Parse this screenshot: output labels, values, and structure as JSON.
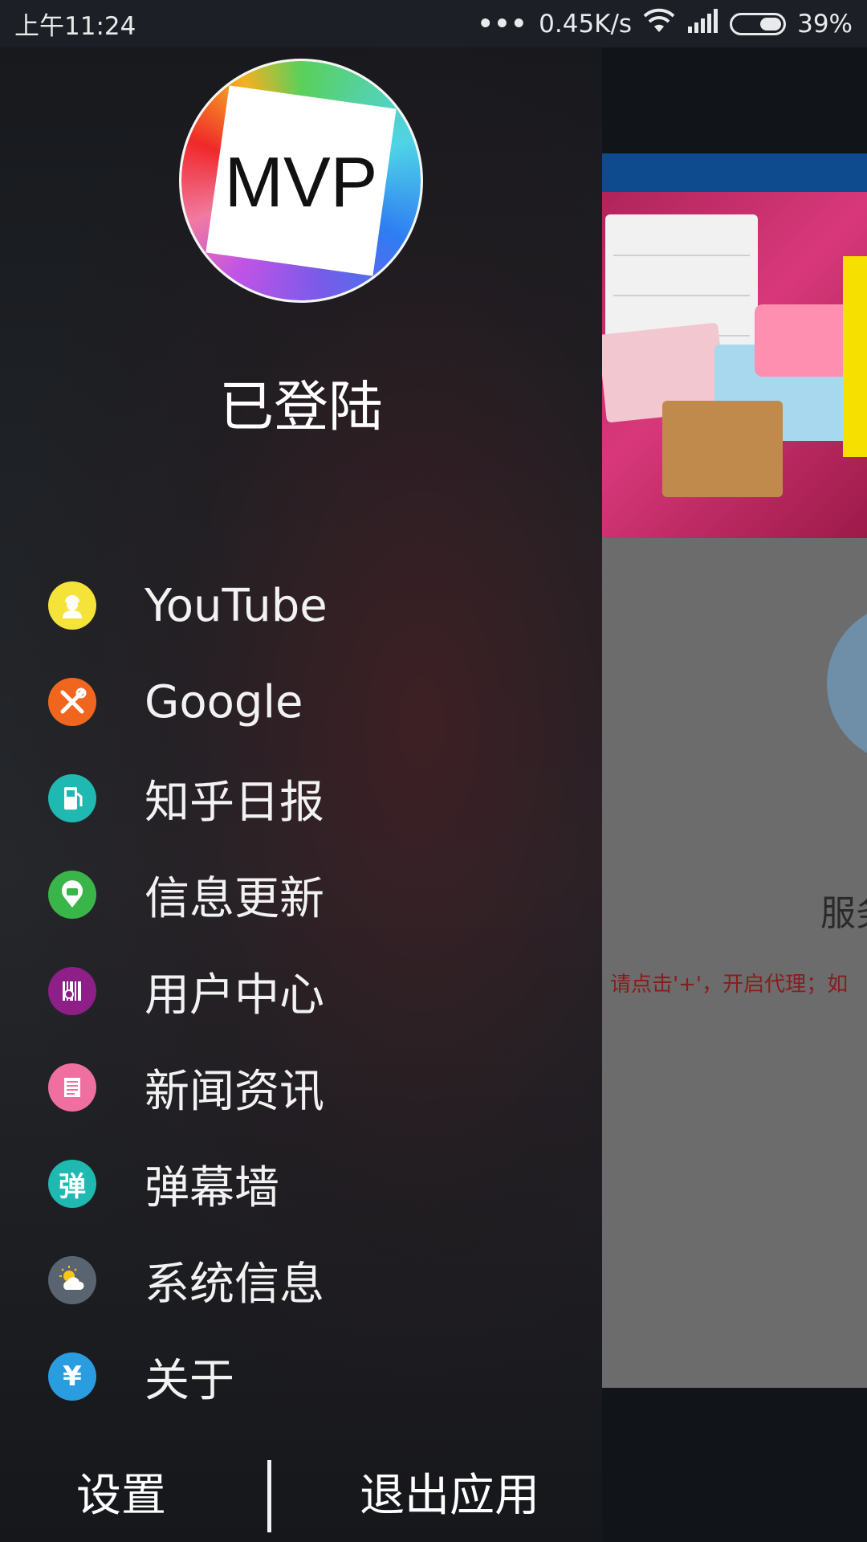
{
  "status_bar": {
    "time": "上午11:24",
    "network_speed": "0.45K/s",
    "battery_percent": "39%",
    "battery_level": 0.39,
    "icons": [
      "more-dots-icon",
      "wifi-icon",
      "signal-icon",
      "battery-icon"
    ]
  },
  "drawer": {
    "avatar_text": "MVP",
    "login_status": "已登陆",
    "menu": [
      {
        "label": "YouTube",
        "icon": "worker-icon",
        "color": "#f6e33a"
      },
      {
        "label": "Google",
        "icon": "tools-icon",
        "color": "#f1661f"
      },
      {
        "label": "知乎日报",
        "icon": "fuel-station-icon",
        "color": "#1fb9b2"
      },
      {
        "label": "信息更新",
        "icon": "car-pin-icon",
        "color": "#39b54a"
      },
      {
        "label": "用户中心",
        "icon": "barcode-icon",
        "color": "#8e1e88"
      },
      {
        "label": "新闻资讯",
        "icon": "document-icon",
        "color": "#ef6fa0"
      },
      {
        "label": "弹幕墙",
        "icon": "dan-char-icon",
        "glyph": "弹",
        "color": "#1fb9b2"
      },
      {
        "label": "系统信息",
        "icon": "weather-icon",
        "color": "#5a6470"
      },
      {
        "label": "关于",
        "icon": "yen-icon",
        "glyph": "¥",
        "color": "#2a9de0"
      }
    ],
    "bottom": {
      "settings_label": "设置",
      "exit_label": "退出应用"
    }
  },
  "background_content": {
    "server_label": "服务",
    "hint": "请点击'+'，开启代理；如"
  },
  "colors": {
    "status_bar_bg": "#1c1f26",
    "content_bg": "#6c6c6c",
    "banner_bg": "#c42a68",
    "hint_text": "#8a1c1c"
  }
}
